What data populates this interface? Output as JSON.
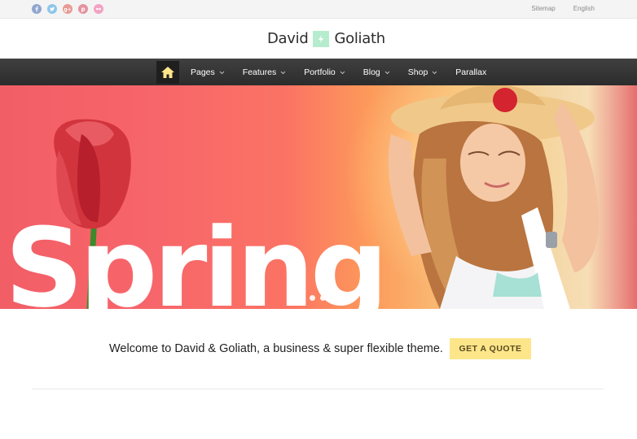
{
  "topbar": {
    "social_icons": [
      "facebook-icon",
      "twitter-icon",
      "googleplus-icon",
      "pinterest-icon",
      "flickr-icon"
    ],
    "sitemap_label": "Sitemap",
    "language_label": "English"
  },
  "logo": {
    "word1": "David",
    "word2": "Goliath",
    "mark_icon": "lightning-icon",
    "mark_color": "#b6ecce"
  },
  "nav": {
    "home_icon": "home-icon",
    "items": [
      {
        "label": "Pages",
        "has_dropdown": true
      },
      {
        "label": "Features",
        "has_dropdown": true
      },
      {
        "label": "Portfolio",
        "has_dropdown": true
      },
      {
        "label": "Blog",
        "has_dropdown": true
      },
      {
        "label": "Shop",
        "has_dropdown": true
      },
      {
        "label": "Parallax",
        "has_dropdown": false
      }
    ]
  },
  "hero": {
    "headline": "Spring",
    "slide_count": 5,
    "active_slide": 1
  },
  "welcome": {
    "message": "Welcome to David & Goliath, a business & super flexible theme.",
    "cta_label": "GET A QUOTE",
    "cta_color": "#fde68a"
  }
}
